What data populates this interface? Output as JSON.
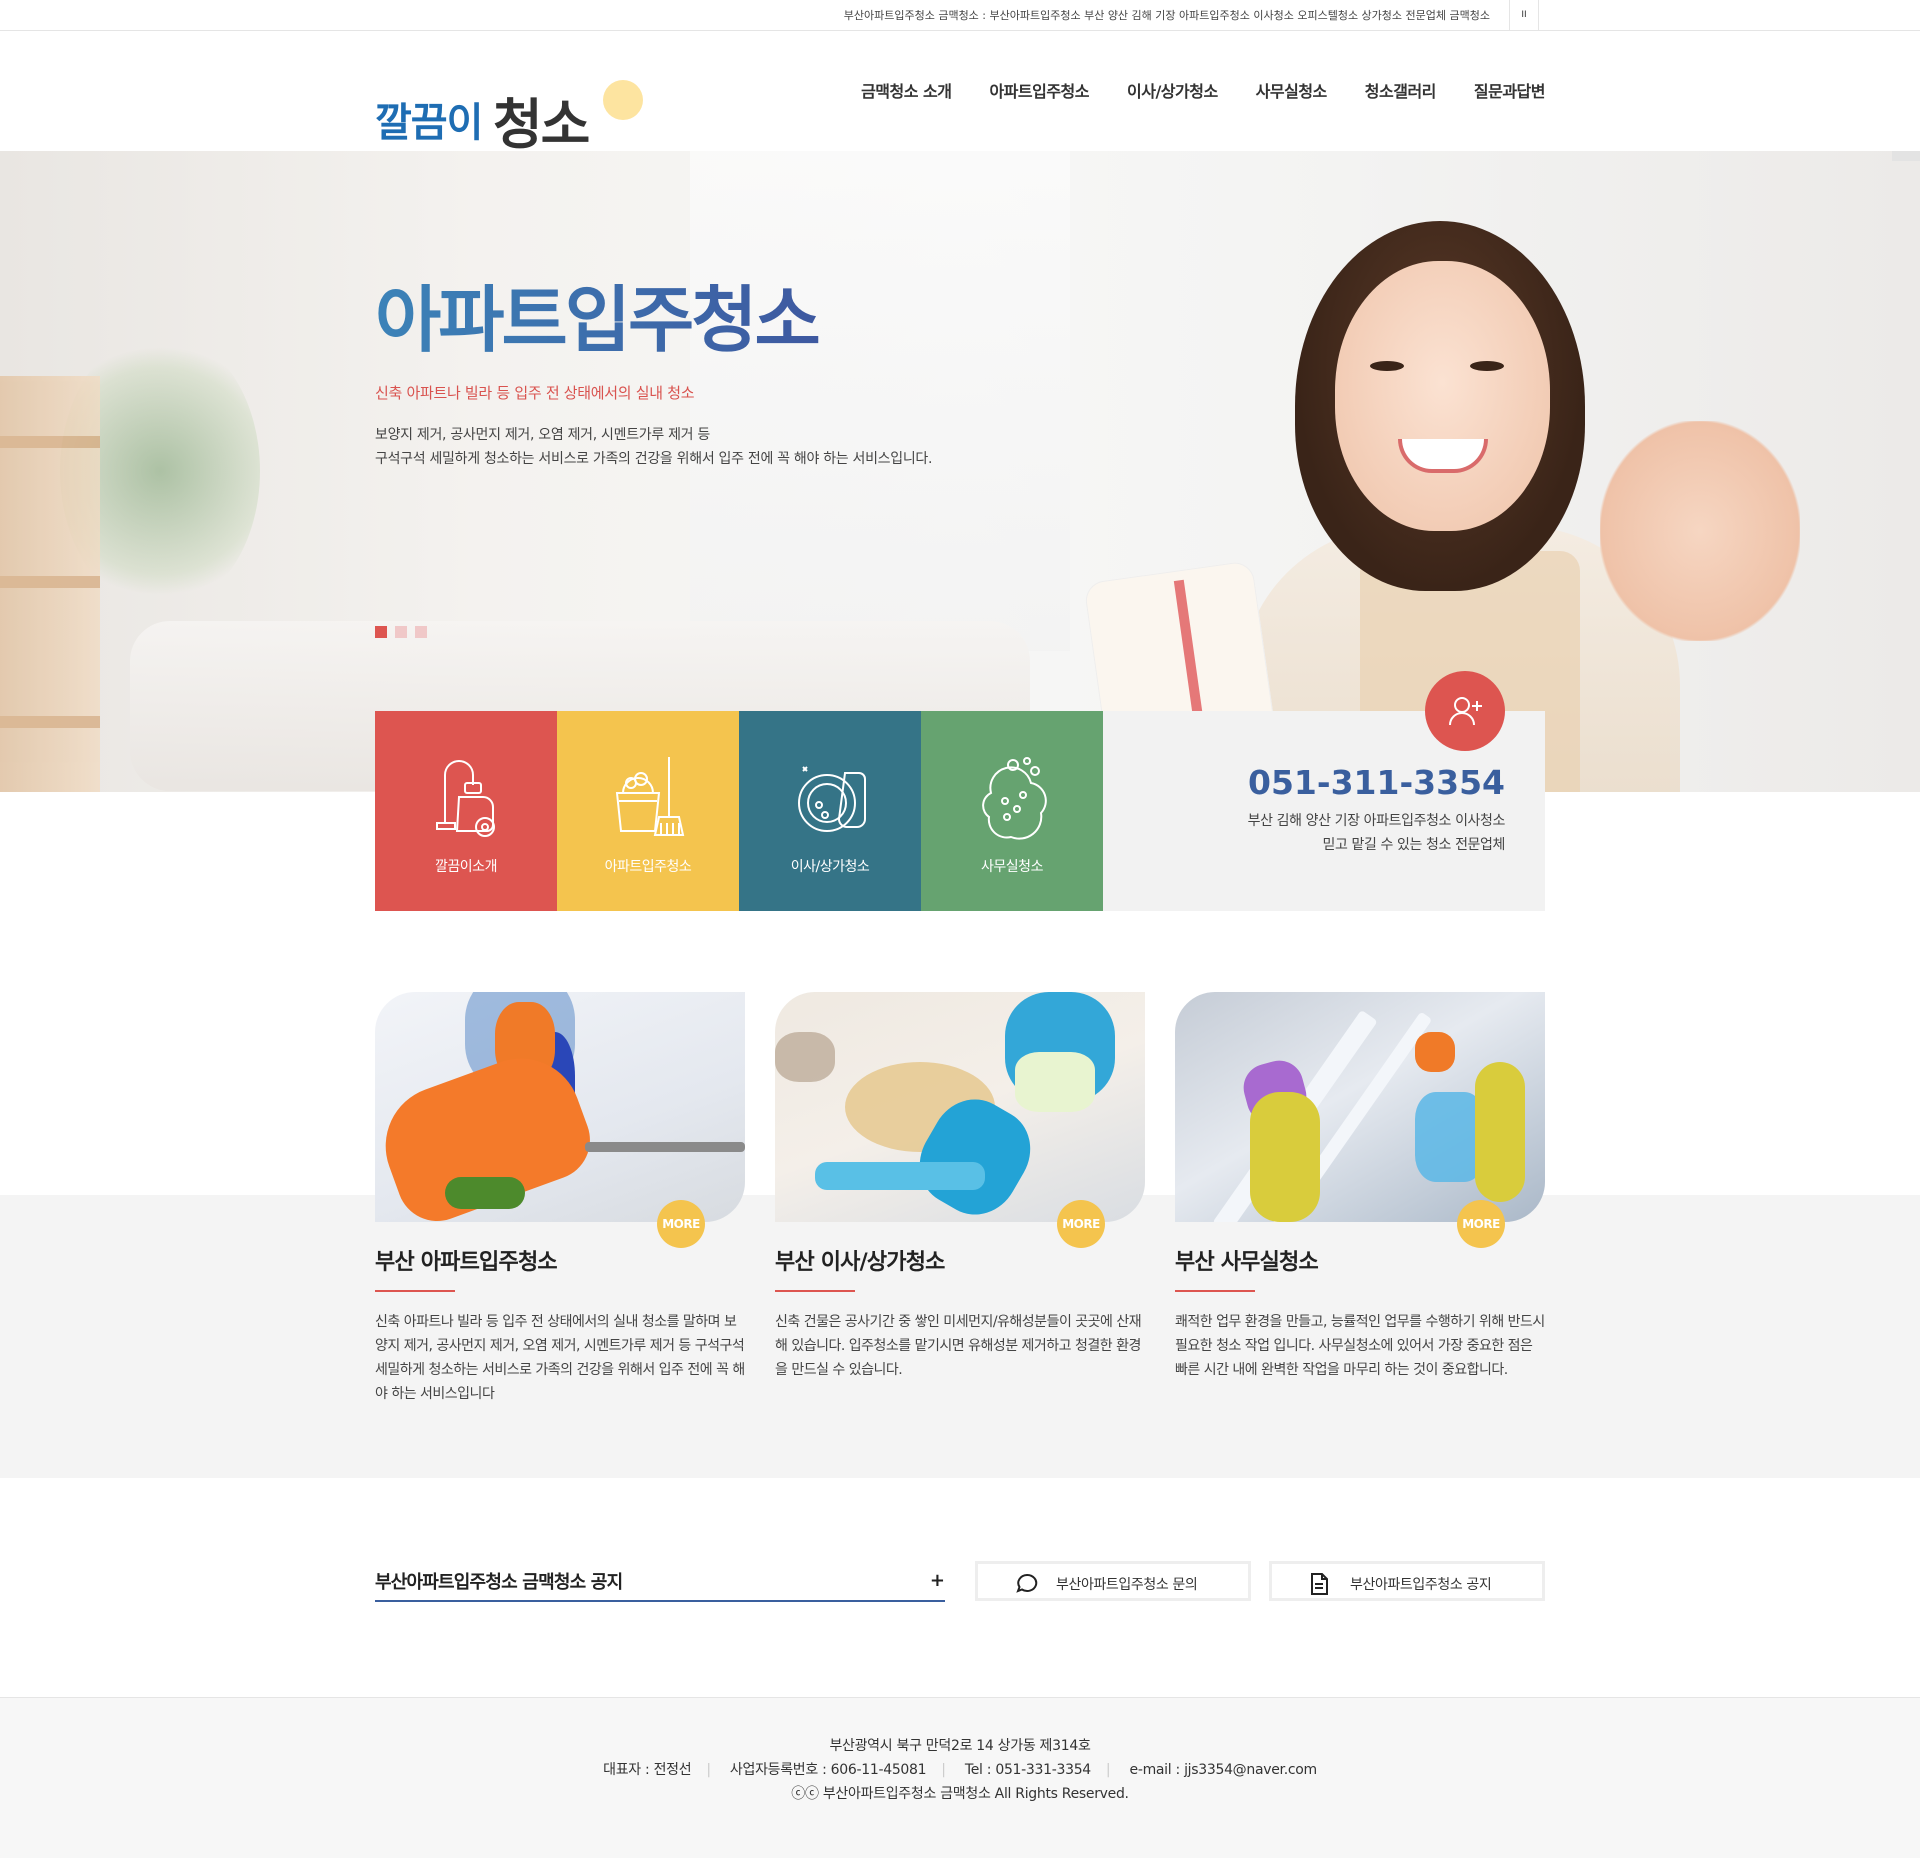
{
  "topbar": {
    "marquee": "부산아파트입주청소 금맥청소 : 부산아파트입주청소 부산 양산 김해 기장 아파트입주청소 이사청소 오피스텔청소 상가청소 전문업체 금맥청소",
    "pause": "II"
  },
  "header": {
    "logo_part1": "깔끔이",
    "logo_part2": "청소",
    "nav": [
      "금맥청소 소개",
      "아파트입주청소",
      "이사/상가청소",
      "사무실청소",
      "청소갤러리",
      "질문과답변"
    ]
  },
  "hero": {
    "title": "아파트입주청소",
    "subtitle": "신축 아파트나 빌라 등 입주 전 상태에서의 실내 청소",
    "desc_line1": "보양지 제거, 공사먼지 제거, 오염 제거, 시멘트가루 제거 등",
    "desc_line2": "구석구석 세밀하게 청소하는 서비스로 가족의 건강을 위해서 입주 전에 꼭 해야 하는 서비스입니다."
  },
  "quick": {
    "tiles": [
      {
        "label": "깔끔이소개",
        "icon": "vacuum-icon"
      },
      {
        "label": "아파트입주청소",
        "icon": "bucket-broom-icon"
      },
      {
        "label": "이사/상가청소",
        "icon": "dish-sponge-icon"
      },
      {
        "label": "사무실청소",
        "icon": "soap-sponge-icon"
      }
    ],
    "phone": "051-311-3354",
    "contact_line1": "부산 김해 양산 기장 아파트입주청소 이사청소",
    "contact_line2": "믿고 맡길 수 있는 청소 전문업체"
  },
  "services": [
    {
      "title": "부산 아파트입주청소",
      "more": "MORE",
      "text": "신축 아파트나 빌라 등 입주 전 상태에서의 실내 청소를 말하며 보양지 제거, 공사먼지 제거, 오염 제거, 시멘트가루 제거 등 구석구석 세밀하게 청소하는 서비스로 가족의 건강을 위해서 입주 전에 꼭 해야 하는 서비스입니다"
    },
    {
      "title": "부산 이사/상가청소",
      "more": "MORE",
      "text": "신축 건물은 공사기간 중 쌓인 미세먼지/유해성분들이 곳곳에 산재해 있습니다. 입주청소를 맡기시면 유해성분 제거하고 청결한 환경을 만드실 수 있습니다."
    },
    {
      "title": "부산 사무실청소",
      "more": "MORE",
      "text": "쾌적한 업무 환경을 만들고, 능률적인 업무를 수행하기 위해 반드시 필요한 청소 작업 입니다. 사무실청소에 있어서 가장 중요한 점은 빠른 시간 내에 완벽한 작업을 마무리 하는 것이 중요합니다."
    }
  ],
  "bottom": {
    "notice_title": "부산아파트입주청소 금맥청소 공지",
    "notice_plus": "+",
    "link1": "부산아파트입주청소 문의",
    "link2": "부산아파트입주청소 공지"
  },
  "footer": {
    "address": "부산광역시 북구 만덕2로 14 상가동 제314호",
    "ceo": "대표자 : 전정선",
    "biz_no": "사업자등록번호 : 606-11-45081",
    "tel": "Tel : 051-331-3354",
    "email": "e-mail : jjs3354@naver.com",
    "copyright": "ⓒⓒ 부산아파트입주청소 금맥청소 All Rights Reserved."
  },
  "colors": {
    "red": "#dd5550",
    "yellow": "#f4c44e",
    "teal": "#357487",
    "green": "#66a370",
    "blue": "#3a5f9e"
  }
}
